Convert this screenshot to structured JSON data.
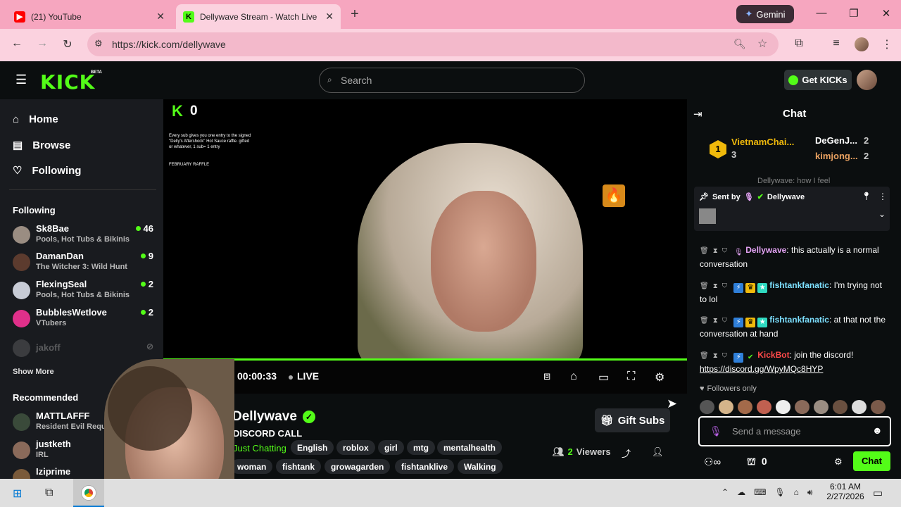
{
  "browser": {
    "tabs": [
      {
        "title": "(21) YouTube",
        "icon": "youtube-icon"
      },
      {
        "title": "Dellywave Stream - Watch Live",
        "icon": "kick-icon"
      }
    ],
    "gemini_label": "Gemini",
    "url": "https://kick.com/dellywave"
  },
  "header": {
    "logo": "KICK",
    "beta": "BETA",
    "search_placeholder": "Search",
    "get_kicks": "Get KICKs"
  },
  "sidebar": {
    "nav": [
      {
        "label": "Home",
        "icon": "home-icon"
      },
      {
        "label": "Browse",
        "icon": "browse-icon"
      },
      {
        "label": "Following",
        "icon": "heart-icon"
      }
    ],
    "following_heading": "Following",
    "following": [
      {
        "name": "Sk8Bae",
        "category": "Pools, Hot Tubs & Bikinis",
        "viewers": "46"
      },
      {
        "name": "DamanDan",
        "category": "The Witcher 3: Wild Hunt",
        "viewers": "9"
      },
      {
        "name": "FlexingSeal",
        "category": "Pools, Hot Tubs & Bikinis",
        "viewers": "2"
      },
      {
        "name": "BubblesWetlove",
        "category": "VTubers",
        "viewers": "2"
      },
      {
        "name": "jakoff",
        "category": "",
        "viewers": ""
      }
    ],
    "show_more": "Show More",
    "recommended_heading": "Recommended",
    "recommended": [
      {
        "name": "MATTLAFFF",
        "category": "Resident Evil Requiem"
      },
      {
        "name": "justketh",
        "category": "IRL"
      },
      {
        "name": "Iziprime",
        "category": ""
      }
    ]
  },
  "video": {
    "kick_count": "0",
    "raffle_text": "Every sub gives you one entry to the signed \"Delly's Aftershock\" Hot Sauce raffle. gifted or whatever, 1 sub= 1 entry",
    "raffle_title": "FEBRUARY RAFFLE",
    "progress": 1.0,
    "time": "00:00:33",
    "live": "LIVE"
  },
  "stream": {
    "streamer": "Dellywave",
    "title": "DISCORD CALL",
    "category": "Just Chatting",
    "tags_row1": [
      "English",
      "roblox",
      "girl",
      "mtg",
      "mentalhealth"
    ],
    "tags_row2": [
      "woman",
      "fishtank",
      "growagarden",
      "fishtanklive",
      "Walking"
    ],
    "gift_subs": "Gift Subs",
    "viewers_count": "2",
    "viewers_label": "Viewers"
  },
  "chat": {
    "title": "Chat",
    "leaderboard": [
      {
        "rank": "1",
        "name": "VietnamChai...",
        "count": "3"
      },
      {
        "name": "DeGenJ...",
        "count": "2"
      },
      {
        "name": "kimjong...",
        "count": "2"
      }
    ],
    "partial_msg": "Dellywave: how I feel",
    "pinned_sent_by": "Sent by",
    "pinned_user": "Dellywave",
    "messages": [
      {
        "user": "Dellywave",
        "text": ": this actually is a normal conversation",
        "color": "#e5a4f5"
      },
      {
        "user": "fishtankfanatic",
        "text": ": I'm trying not to lol",
        "color": "#7de0ff"
      },
      {
        "user": "fishtankfanatic",
        "text": ": at that not the conversation at hand",
        "color": "#7de0ff"
      },
      {
        "user": "KickBot",
        "text": ": join the discord!",
        "color": "#ff4a4a",
        "link": "https://discord.gg/WpyMQc8HYP"
      }
    ],
    "followers_only": "Followers only",
    "input_placeholder": "Send a message",
    "points": "0",
    "chat_button": "Chat"
  },
  "taskbar": {
    "time": "6:01 AM",
    "date": "2/27/2026"
  },
  "colors": {
    "kick_green": "#53fc18",
    "bg": "#0b0e0f",
    "sidebar": "#191b1f",
    "tab_bar": "#f6a6bf"
  }
}
